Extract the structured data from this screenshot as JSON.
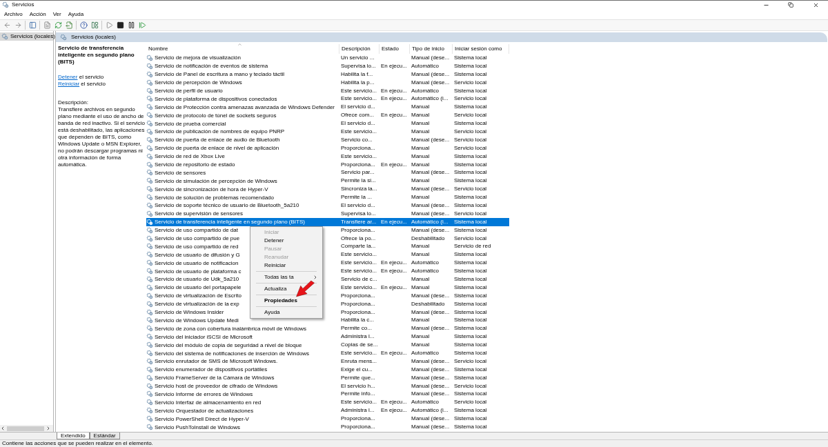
{
  "window": {
    "title": "Servicios"
  },
  "menu": [
    "Archivo",
    "Acción",
    "Ver",
    "Ayuda"
  ],
  "tree": {
    "items": [
      {
        "label": "Servicios (locales)",
        "selected": true
      }
    ]
  },
  "pane_header": "Servicios (locales)",
  "detail": {
    "title": "Servicio de transferencia inteligente en segundo plano (BITS)",
    "actions": [
      {
        "link": "Detener",
        "rest": "el servicio"
      },
      {
        "link": "Reiniciar",
        "rest": "el servicio"
      }
    ],
    "description_label": "Descripción:",
    "description": "Transfiere archivos en segundo plano mediante el uso de ancho de banda de red inactivo. Si el servicio está deshabilitado, las aplicaciones que dependen de BITS, como Windows Update o MSN Explorer, no podrán descargar programas ni otra información de forma automática."
  },
  "table": {
    "columns": [
      "Nombre",
      "Descripción",
      "Estado",
      "Tipo de inicio",
      "Iniciar sesión como"
    ],
    "rows": [
      {
        "name": "Servicio de mejora de visualización",
        "description": "Un servicio ...",
        "startup": "Manual (dese...",
        "logon": "Sistema local",
        "selected": false
      },
      {
        "name": "Servicio de notificación de eventos de sistema",
        "description": "Supervisa lo...",
        "status": "En ejecu...",
        "startup": "Automático",
        "logon": "Sistema local",
        "selected": false
      },
      {
        "name": "Servicio de Panel de escritura a mano y teclado táctil",
        "description": "Habilita la f...",
        "startup": "Manual (dese...",
        "logon": "Sistema local",
        "selected": false
      },
      {
        "name": "Servicio de percepción de Windows",
        "description": "Habilita la p...",
        "startup": "Manual (dese...",
        "logon": "Servicio local",
        "selected": false
      },
      {
        "name": "Servicio de perfil de usuario",
        "description": "Este servicio...",
        "status": "En ejecu...",
        "startup": "Automático",
        "logon": "Sistema local",
        "selected": false
      },
      {
        "name": "Servicio de plataforma de dispositivos conectados",
        "description": "Este servicio...",
        "status": "En ejecu...",
        "startup": "Automático (i...",
        "logon": "Servicio local",
        "selected": false
      },
      {
        "name": "Servicio de Protección contra amenazas avanzada de Windows Defender",
        "description": "El servicio d...",
        "startup": "Manual",
        "logon": "Sistema local",
        "selected": false
      },
      {
        "name": "Servicio de protocolo de túnel de sockets seguros",
        "description": "Ofrece com...",
        "status": "En ejecu...",
        "startup": "Manual",
        "logon": "Servicio local",
        "selected": false
      },
      {
        "name": "Servicio de prueba comercial",
        "description": "El servicio d...",
        "startup": "Manual",
        "logon": "Sistema local",
        "selected": false
      },
      {
        "name": "Servicio de publicación de nombres de equipo PNRP",
        "description": "Este servicio...",
        "startup": "Manual",
        "logon": "Servicio local",
        "selected": false
      },
      {
        "name": "Servicio de puerta de enlace de audio de Bluetooth",
        "description": "Servicio co...",
        "startup": "Manual (dese...",
        "logon": "Servicio local",
        "selected": false
      },
      {
        "name": "Servicio de puerta de enlace de nivel de aplicación",
        "description": "Proporciona...",
        "startup": "Manual",
        "logon": "Servicio local",
        "selected": false
      },
      {
        "name": "Servicio de red de Xbox Live",
        "description": "Este servicio...",
        "startup": "Manual",
        "logon": "Sistema local",
        "selected": false
      },
      {
        "name": "Servicio de repositorio de estado",
        "description": "Proporciona...",
        "status": "En ejecu...",
        "startup": "Manual",
        "logon": "Sistema local",
        "selected": false
      },
      {
        "name": "Servicio de sensores",
        "description": "Servicio par...",
        "startup": "Manual (dese...",
        "logon": "Sistema local",
        "selected": false
      },
      {
        "name": "Servicio de simulación de percepción de Windows",
        "description": "Permite la si...",
        "startup": "Manual",
        "logon": "Sistema local",
        "selected": false
      },
      {
        "name": "Servicio de sincronización de hora de Hyper-V",
        "description": "Sincroniza la...",
        "startup": "Manual (dese...",
        "logon": "Servicio local",
        "selected": false
      },
      {
        "name": "Servicio de solución de problemas recomendado",
        "description": "Permite la ...",
        "startup": "Manual",
        "logon": "Sistema local",
        "selected": false
      },
      {
        "name": "Servicio de soporte técnico de usuario de Bluetooth_5a210",
        "description": "El servicio d...",
        "startup": "Manual (dese...",
        "logon": "Sistema local",
        "selected": false
      },
      {
        "name": "Servicio de supervisión de sensores",
        "description": "Supervisa lo...",
        "startup": "Manual (dese...",
        "logon": "Servicio local",
        "selected": false
      },
      {
        "name": "Servicio de transferencia inteligente en segundo plano (BITS)",
        "description": "Transfiere ar...",
        "status": "En ejecu...",
        "startup": "Automático (i...",
        "logon": "Sistema local",
        "selected": true
      },
      {
        "name": "Servicio de uso compartido de dat",
        "description": "Proporciona...",
        "startup": "Manual (dese...",
        "logon": "Sistema local",
        "selected": false
      },
      {
        "name": "Servicio de uso compartido de pue",
        "description": "Ofrece la po...",
        "startup": "Deshabilitado",
        "logon": "Servicio local",
        "selected": false
      },
      {
        "name": "Servicio de uso compartido de red",
        "description": "Comparte la...",
        "startup": "Manual",
        "logon": "Servicio de red",
        "selected": false
      },
      {
        "name": "Servicio de usuario de difusión y G",
        "description": "Este servicio...",
        "startup": "Manual",
        "logon": "Sistema local",
        "selected": false
      },
      {
        "name": "Servicio de usuario de notificacion",
        "description": "Este servicio...",
        "status": "En ejecu...",
        "startup": "Automático",
        "logon": "Sistema local",
        "selected": false
      },
      {
        "name": "Servicio de usuario de plataforma c",
        "description": "Este servicio...",
        "status": "En ejecu...",
        "startup": "Automático",
        "logon": "Sistema local",
        "selected": false
      },
      {
        "name": "Servicio de usuario de Udk_5a210",
        "description": "Servicio de c...",
        "startup": "Manual",
        "logon": "Sistema local",
        "selected": false
      },
      {
        "name": "Servicio de usuario del portapapele",
        "description": "Este servicio...",
        "status": "En ejecu...",
        "startup": "Manual",
        "logon": "Sistema local",
        "selected": false
      },
      {
        "name": "Servicio de virtualización de Escrito",
        "description": "Proporciona...",
        "startup": "Manual (dese...",
        "logon": "Sistema local",
        "selected": false
      },
      {
        "name": "Servicio de virtualización de la exp",
        "description": "Proporciona...",
        "startup": "Deshabilitado",
        "logon": "Sistema local",
        "selected": false
      },
      {
        "name": "Servicio de Windows Insider",
        "description": "Proporciona...",
        "startup": "Manual (dese...",
        "logon": "Sistema local",
        "selected": false
      },
      {
        "name": "Servicio de Windows Update Medi",
        "description": "Habilita la c...",
        "startup": "Manual",
        "logon": "Sistema local",
        "selected": false
      },
      {
        "name": "Servicio de zona con cobertura inalámbrica móvil de Windows",
        "description": "Permite co...",
        "startup": "Manual (dese...",
        "logon": "Sistema local",
        "selected": false
      },
      {
        "name": "Servicio del iniciador iSCSI de Microsoft",
        "description": "Administra l...",
        "startup": "Manual",
        "logon": "Sistema local",
        "selected": false
      },
      {
        "name": "Servicio del módulo de copia de seguridad a nivel de bloque",
        "description": "Copias de se...",
        "startup": "Manual",
        "logon": "Sistema local",
        "selected": false
      },
      {
        "name": "Servicio del sistema de notificaciones de inserción de Windows",
        "description": "Este servicio...",
        "status": "En ejecu...",
        "startup": "Automático",
        "logon": "Sistema local",
        "selected": false
      },
      {
        "name": "Servicio enrutador de SMS de Microsoft Windows.",
        "description": "Enruta mens...",
        "startup": "Manual (dese...",
        "logon": "Servicio local",
        "selected": false
      },
      {
        "name": "Servicio enumerador de dispositivos portátiles",
        "description": "Exige el cu...",
        "startup": "Manual (dese...",
        "logon": "Sistema local",
        "selected": false
      },
      {
        "name": "Servicio FrameServer de la Cámara de Windows",
        "description": "Permite que...",
        "startup": "Manual (dese...",
        "logon": "Sistema local",
        "selected": false
      },
      {
        "name": "Servicio host de proveedor de cifrado de Windows",
        "description": "El servicio h...",
        "startup": "Manual (dese...",
        "logon": "Servicio local",
        "selected": false
      },
      {
        "name": "Servicio Informe de errores de Windows",
        "description": "Permite info...",
        "startup": "Manual (dese...",
        "logon": "Sistema local",
        "selected": false
      },
      {
        "name": "Servicio Interfaz de almacenamiento en red",
        "description": "Este servicio...",
        "status": "En ejecu...",
        "startup": "Automático",
        "logon": "Servicio local",
        "selected": false
      },
      {
        "name": "Servicio Orquestador de actualizaciones",
        "description": "Administra l...",
        "status": "En ejecu...",
        "startup": "Automático (i...",
        "logon": "Sistema local",
        "selected": false
      },
      {
        "name": "Servicio PowerShell Direct de Hyper-V",
        "description": "Proporciona...",
        "startup": "Manual (dese...",
        "logon": "Sistema local",
        "selected": false
      },
      {
        "name": "Servicio PushToInstall de Windows",
        "description": "Proporciona...",
        "startup": "Manual (dese...",
        "logon": "Sistema local",
        "selected": false
      }
    ]
  },
  "context_menu": {
    "items": [
      {
        "kind": "item",
        "label": "Iniciar",
        "disabled": true,
        "default": false,
        "submenu": false
      },
      {
        "kind": "item",
        "label": "Detener",
        "disabled": false,
        "default": false,
        "submenu": false
      },
      {
        "kind": "item",
        "label": "Pausar",
        "disabled": true,
        "default": false,
        "submenu": false
      },
      {
        "kind": "item",
        "label": "Reanudar",
        "disabled": true,
        "default": false,
        "submenu": false
      },
      {
        "kind": "item",
        "label": "Reiniciar",
        "disabled": false,
        "default": false,
        "submenu": false
      },
      {
        "kind": "separator"
      },
      {
        "kind": "item",
        "label": "Todas las ta",
        "disabled": false,
        "default": false,
        "submenu": true
      },
      {
        "kind": "separator"
      },
      {
        "kind": "item",
        "label": "Actualiza",
        "disabled": false,
        "default": false,
        "submenu": false
      },
      {
        "kind": "separator"
      },
      {
        "kind": "item",
        "label": "Propiedades",
        "disabled": false,
        "default": true,
        "submenu": false
      },
      {
        "kind": "separator"
      },
      {
        "kind": "item",
        "label": "Ayuda",
        "disabled": false,
        "default": false,
        "submenu": false
      }
    ]
  },
  "tabs": [
    {
      "label": "Extendido",
      "selected": true
    },
    {
      "label": "Estándar",
      "selected": false
    }
  ],
  "status_bar": "Contiene las acciones que se pueden realizar en el elemento."
}
